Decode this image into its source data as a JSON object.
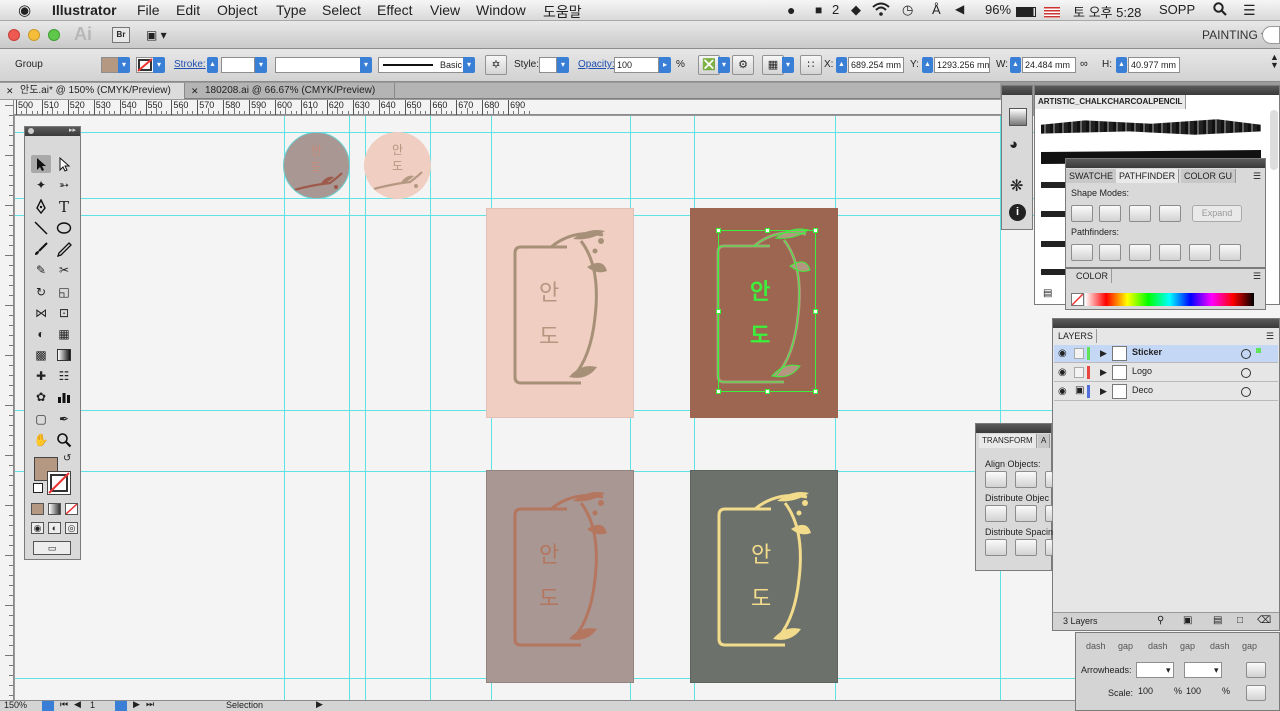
{
  "menubar": {
    "apple_icon": "apple-icon",
    "app_name": "Illustrator",
    "items": [
      "File",
      "Edit",
      "Object",
      "Type",
      "Select",
      "Effect",
      "View",
      "Window",
      "도움말"
    ],
    "status": {
      "notifications": "2",
      "battery": "96%",
      "clock": "토 오후 5:28",
      "user": "SOPP"
    }
  },
  "appbar": {
    "logo": "Ai",
    "bridge": "Br",
    "workspace": "PAINTING ▾"
  },
  "control": {
    "selection_type": "Group",
    "fill_color": "#b49882",
    "stroke_label": "Stroke:",
    "brush_label": "Basic",
    "style_label": "Style:",
    "opacity_label": "Opacity:",
    "opacity_value": "100",
    "opacity_unit": "%",
    "x_label": "X:",
    "x_value": "689.254 mm",
    "y_label": "Y:",
    "y_value": "1293.256 mm",
    "w_label": "W:",
    "w_value": "24.484 mm",
    "h_label": "H:",
    "h_value": "40.977 mm"
  },
  "tabs": [
    {
      "title": "안도.ai* @ 150% (CMYK/Preview)",
      "active": true
    },
    {
      "title": "180208.ai @ 66.67% (CMYK/Preview)",
      "active": false
    }
  ],
  "ruler": {
    "h_ticks": [
      "500",
      "510",
      "520",
      "530",
      "540",
      "550",
      "560",
      "570",
      "580",
      "590",
      "600",
      "610",
      "620",
      "630",
      "640",
      "650",
      "660",
      "670",
      "680",
      "690"
    ]
  },
  "artwork": {
    "circle_text": [
      "안",
      "도"
    ],
    "card_text": [
      "안",
      "도"
    ],
    "colors": {
      "pink": "#f0cec1",
      "brown": "#9d6651",
      "mauve": "#a89793",
      "gray": "#6d716b",
      "tan": "#b49882",
      "rust": "#b5765f",
      "gold": "#f2dc8b",
      "select": "#3cf03c"
    }
  },
  "brushes_panel": {
    "title": "ARTISTIC_CHALKCHARCOALPENCIL"
  },
  "pathfinder_panel": {
    "tabs": [
      "SWATCHE",
      "PATHFINDER",
      "COLOR GU"
    ],
    "shape_modes_label": "Shape Modes:",
    "expand_label": "Expand",
    "pathfinders_label": "Pathfinders:",
    "color_tab": "COLOR"
  },
  "layers_panel": {
    "tab": "LAYERS",
    "layers": [
      {
        "name": "Sticker",
        "color": "#61e25b",
        "selected": true,
        "locked": false
      },
      {
        "name": "Logo",
        "color": "#e8463e",
        "selected": false,
        "locked": false
      },
      {
        "name": "Deco",
        "color": "#4f6fdd",
        "selected": false,
        "locked": true
      }
    ],
    "count": "3 Layers"
  },
  "align_panel": {
    "tab": "TRANSFORM",
    "tab2": "A",
    "align_label": "Align Objects:",
    "distribute_label": "Distribute Objec",
    "spacing_label": "Distribute Spacin"
  },
  "stroke_panel": {
    "dash_gap": [
      "dash",
      "gap",
      "dash",
      "gap",
      "dash",
      "gap"
    ],
    "arrowheads_label": "Arrowheads:",
    "scale_label": "Scale:",
    "scale1": "100",
    "scale2": "100",
    "scale_unit": "%"
  },
  "statusbar": {
    "zoom": "150%",
    "page": "1",
    "tool": "Selection"
  }
}
